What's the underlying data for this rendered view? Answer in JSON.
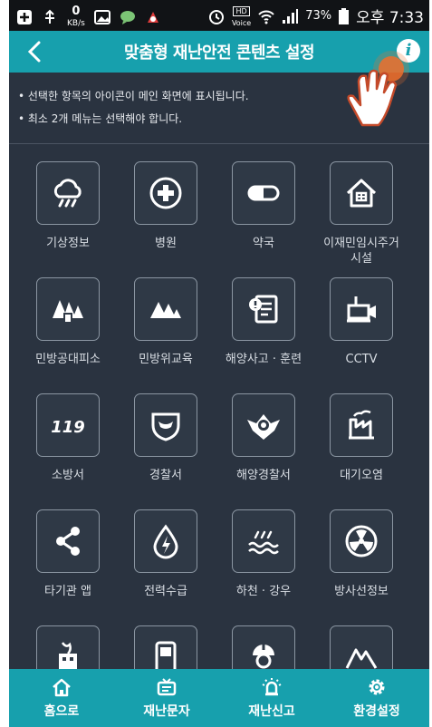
{
  "status_bar": {
    "battery": "73%",
    "time": "오후 7:33",
    "speed_value": "0",
    "speed_unit": "KB/s",
    "voice_label": "Voice"
  },
  "header": {
    "title": "맞춤형 재난안전 콘텐츠 설정",
    "back_icon": "chevron-left-icon",
    "info_icon": "info-icon",
    "info_glyph": "i"
  },
  "notes": [
    "• 선택한 항목의 아이콘이 메인 화면에 표시됩니다.",
    "• 최소 2개 메뉴는 선택해야 합니다."
  ],
  "tiles": [
    {
      "label": "기상정보",
      "icon": "weather-cloud-icon"
    },
    {
      "label": "병원",
      "icon": "hospital-cross-icon"
    },
    {
      "label": "약국",
      "icon": "pill-icon"
    },
    {
      "label": "이재민임시주거시설",
      "label_line1": "이재민임시주거",
      "label_line2": "시설",
      "icon": "house-icon"
    },
    {
      "label": "민방공대피소",
      "icon": "shelter-icon"
    },
    {
      "label": "민방위교육",
      "icon": "mountain-icon"
    },
    {
      "label": "해양사고 · 훈련",
      "icon": "marine-accident-icon"
    },
    {
      "label": "CCTV",
      "icon": "cctv-camera-icon"
    },
    {
      "label": "소방서",
      "icon": "119-icon"
    },
    {
      "label": "경찰서",
      "icon": "police-badge-icon"
    },
    {
      "label": "해양경찰서",
      "icon": "coast-guard-emblem-icon"
    },
    {
      "label": "대기오염",
      "icon": "factory-icon"
    },
    {
      "label": "타기관 앱",
      "icon": "share-icon"
    },
    {
      "label": "전력수급",
      "icon": "power-drop-icon"
    },
    {
      "label": "하천 · 강우",
      "icon": "river-waves-icon"
    },
    {
      "label": "방사선정보",
      "icon": "radiation-icon"
    },
    {
      "label": "",
      "icon": "building-fire-icon"
    },
    {
      "label": "",
      "icon": "device-icon"
    },
    {
      "label": "",
      "icon": "helmet-person-icon"
    },
    {
      "label": "",
      "icon": "mountain-fire-icon"
    }
  ],
  "bottom_nav": [
    {
      "label": "홈으로",
      "icon": "home-icon"
    },
    {
      "label": "재난문자",
      "icon": "message-tv-icon"
    },
    {
      "label": "재난신고",
      "icon": "siren-icon"
    },
    {
      "label": "환경설정",
      "icon": "gear-icon"
    }
  ],
  "colors": {
    "header": "#17a0ad",
    "background": "#2a3340",
    "tile_border": "#8b96a2",
    "hand_dot": "#ef6f2c"
  }
}
